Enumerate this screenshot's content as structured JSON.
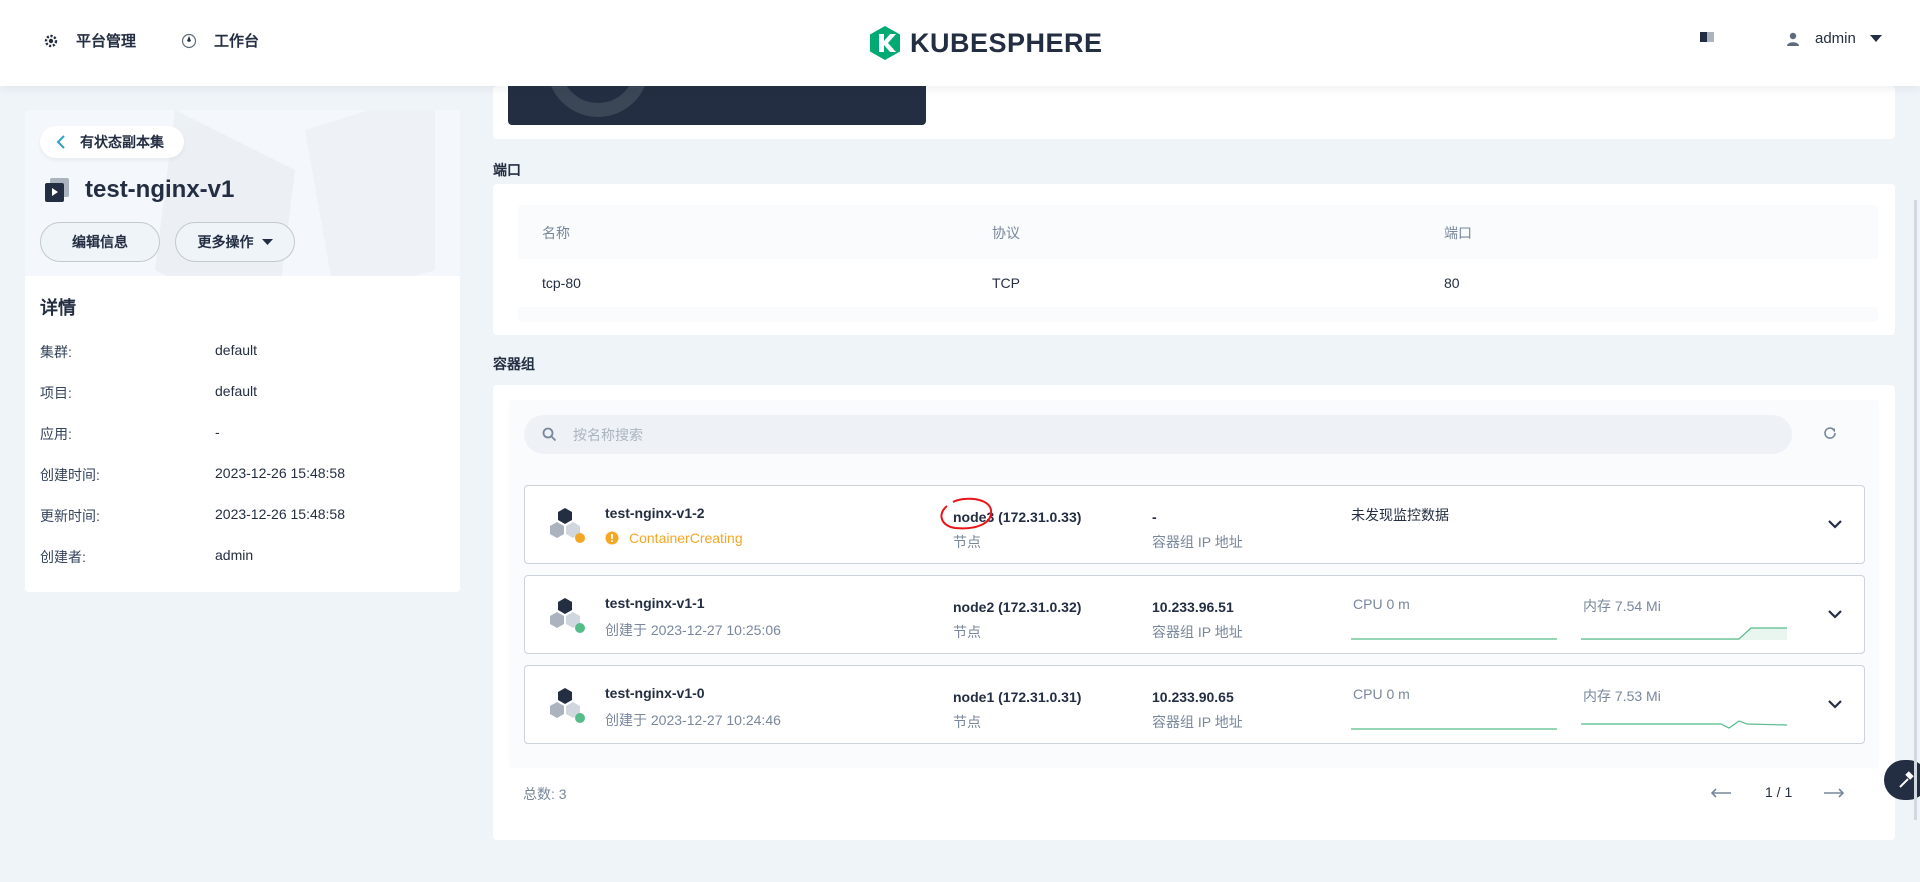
{
  "header": {
    "nav_platform": "平台管理",
    "nav_workbench": "工作台",
    "logo": "KUBESPHERE",
    "user": "admin",
    "brand_color": "#00aa72"
  },
  "left": {
    "back_label": "有状态副本集",
    "title": "test-nginx-v1",
    "edit_button": "编辑信息",
    "more_button": "更多操作",
    "details_title": "详情",
    "details": [
      {
        "k": "集群:",
        "v": "default"
      },
      {
        "k": "项目:",
        "v": "default"
      },
      {
        "k": "应用:",
        "v": "-"
      },
      {
        "k": "创建时间:",
        "v": "2023-12-26 15:48:58"
      },
      {
        "k": "更新时间:",
        "v": "2023-12-26 15:48:58"
      },
      {
        "k": "创建者:",
        "v": "admin"
      }
    ]
  },
  "ports": {
    "section_title": "端口",
    "headers": [
      "名称",
      "协议",
      "端口"
    ],
    "rows": [
      [
        "tcp-80",
        "TCP",
        "80"
      ]
    ]
  },
  "pods": {
    "section_title": "容器组",
    "search_placeholder": "按名称搜索",
    "items": [
      {
        "name": "test-nginx-v1-2",
        "status": "ContainerCreating",
        "node": "node3",
        "node_ip": "(172.31.0.33)",
        "node_label": "节点",
        "pod_ip": "-",
        "pod_ip_label": "容器组 IP 地址",
        "monitor": "未发现监控数据"
      },
      {
        "name": "test-nginx-v1-1",
        "created": "创建于 2023-12-27 10:25:06",
        "node": "node2",
        "node_ip": "(172.31.0.32)",
        "node_label": "节点",
        "pod_ip": "10.233.96.51",
        "pod_ip_label": "容器组 IP 地址",
        "cpu": "CPU 0 m",
        "mem": "内存 7.54 Mi"
      },
      {
        "name": "test-nginx-v1-0",
        "created": "创建于 2023-12-27 10:24:46",
        "node": "node1",
        "node_ip": "(172.31.0.31)",
        "node_label": "节点",
        "pod_ip": "10.233.90.65",
        "pod_ip_label": "容器组 IP 地址",
        "cpu": "CPU 0 m",
        "mem": "内存 7.53 Mi"
      }
    ],
    "total": "总数:  3",
    "page": "1 / 1"
  }
}
